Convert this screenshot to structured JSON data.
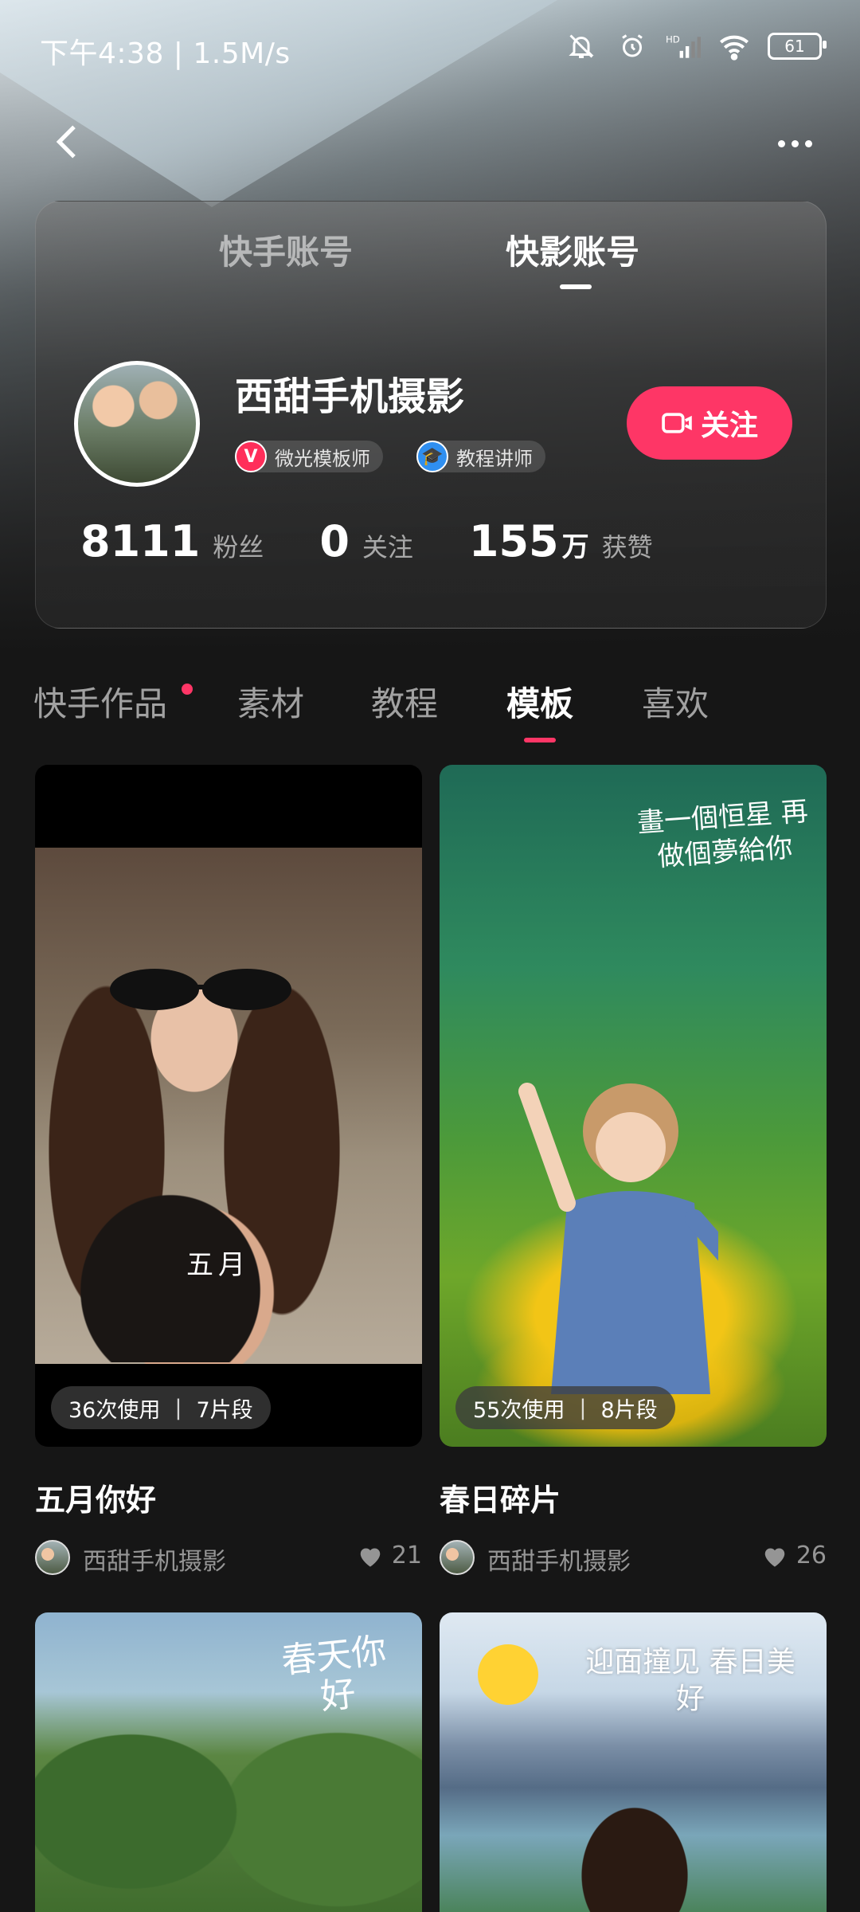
{
  "status_bar": {
    "time": "下午4:38",
    "speed": "1.5M/s",
    "battery": "61"
  },
  "account_tabs": [
    {
      "label": "快手账号",
      "active": false
    },
    {
      "label": "快影账号",
      "active": true
    }
  ],
  "profile": {
    "name": "西甜手机摄影",
    "badges": [
      {
        "icon_text": "V",
        "label": "微光模板师"
      },
      {
        "icon_text": "🎓",
        "label": "教程讲师"
      }
    ],
    "follow_button": "关注",
    "stats": [
      {
        "value": "8111",
        "unit": "",
        "label": "粉丝"
      },
      {
        "value": "0",
        "unit": "",
        "label": "关注"
      },
      {
        "value": "155",
        "unit": "万",
        "label": "获赞"
      }
    ]
  },
  "content_tabs": [
    {
      "label": "快手作品",
      "active": false,
      "has_dot": true
    },
    {
      "label": "素材",
      "active": false
    },
    {
      "label": "教程",
      "active": false
    },
    {
      "label": "模板",
      "active": true
    },
    {
      "label": "喜欢",
      "active": false
    }
  ],
  "items": [
    {
      "usage": "36次使用",
      "segments": "7片段",
      "overlay_text": "五月",
      "title": "五月你好",
      "author": "西甜手机摄影",
      "likes": "21"
    },
    {
      "usage": "55次使用",
      "segments": "8片段",
      "overlay_text": "畫一個恒星 再做個夢給你",
      "title": "春日碎片",
      "author": "西甜手机摄影",
      "likes": "26"
    },
    {
      "overlay_text": "春天你好"
    },
    {
      "overlay_text": "迎面撞见 春日美好"
    }
  ],
  "colors": {
    "accent": "#fe3666",
    "background": "#161616"
  }
}
